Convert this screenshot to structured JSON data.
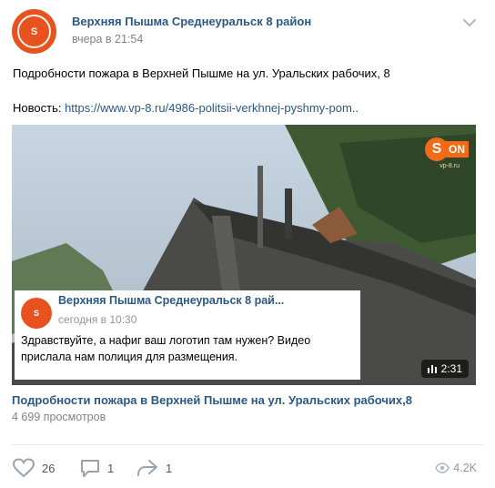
{
  "post": {
    "author": "Верхняя Пышма Среднеуральск 8 район",
    "time": "вчера в 21:54",
    "text_line1": "Подробности пожара в Верхней Пышме на ул. Уральских рабочих, 8",
    "text_prefix": "Новость: ",
    "link": "https://www.vp-8.ru/4986-politsii-verkhnej-pyshmy-pom.."
  },
  "video": {
    "brand_s": "S",
    "brand_on": "ON",
    "brand_sub": "vp-8.ru",
    "overlay_name": "Верхняя Пышма Среднеуральск 8 рай...",
    "overlay_time": "сегодня в 10:30",
    "overlay_text": "Здравствуйте, а нафиг ваш логотип там нужен? Видео прислала нам полиция для размещения.",
    "duration": "2:31",
    "title": "Подробности пожара в Верхней Пышме на ул. Уральских рабочих,8",
    "views": "4 699 просмотров"
  },
  "actions": {
    "likes": "26",
    "comments": "1",
    "shares": "1",
    "views": "4.2K"
  }
}
